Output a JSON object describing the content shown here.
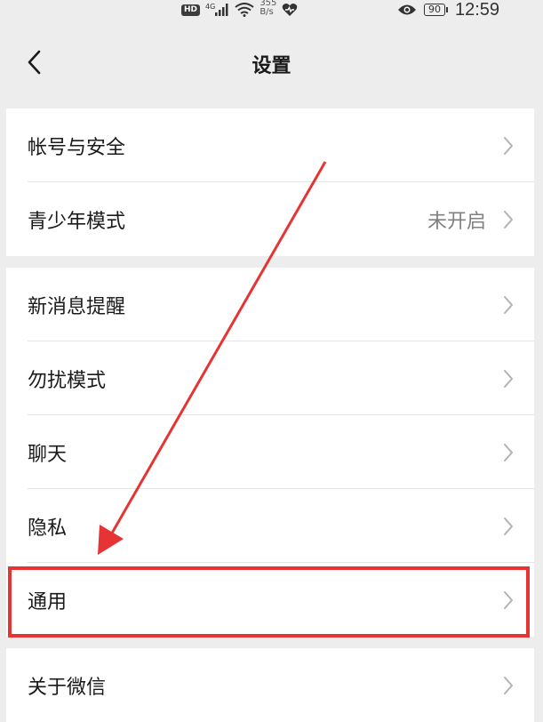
{
  "status_bar": {
    "hd": "HD",
    "network": "4G",
    "speed_value": "355",
    "speed_unit": "B/s",
    "battery": "90",
    "time": "12:59"
  },
  "nav": {
    "title": "设置"
  },
  "groups": [
    {
      "items": [
        {
          "label": "帐号与安全",
          "value": ""
        },
        {
          "label": "青少年模式",
          "value": "未开启"
        }
      ]
    },
    {
      "items": [
        {
          "label": "新消息提醒",
          "value": ""
        },
        {
          "label": "勿扰模式",
          "value": ""
        },
        {
          "label": "聊天",
          "value": ""
        },
        {
          "label": "隐私",
          "value": ""
        },
        {
          "label": "通用",
          "value": ""
        }
      ]
    },
    {
      "items": [
        {
          "label": "关于微信",
          "value": ""
        }
      ]
    }
  ],
  "annotation": {
    "highlight_color": "#e63434",
    "target_item": "通用"
  }
}
